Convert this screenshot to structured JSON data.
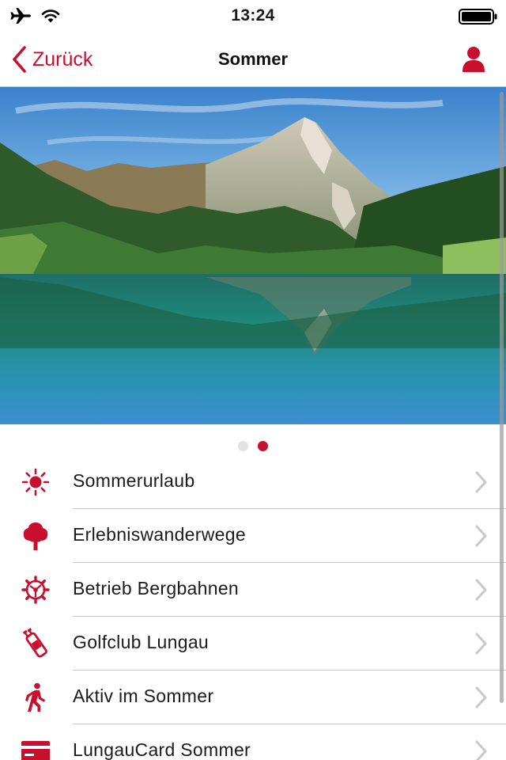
{
  "status_bar": {
    "time": "13:24",
    "icons": [
      "airplane-icon",
      "wifi-icon",
      "battery-icon"
    ]
  },
  "nav": {
    "back_label": "Zurück",
    "title": "Sommer",
    "profile_icon": "user-icon"
  },
  "hero": {
    "image": "mountain-lake-photo",
    "pager_count": 2,
    "pager_active_index": 1
  },
  "menu": {
    "items": [
      {
        "label": "Sommerurlaub",
        "icon": "sun-icon"
      },
      {
        "label": "Erlebniswanderwege",
        "icon": "tree-icon"
      },
      {
        "label": "Betrieb Bergbahnen",
        "icon": "gear-icon"
      },
      {
        "label": "Golfclub Lungau",
        "icon": "golf-bag-icon"
      },
      {
        "label": "Aktiv im Sommer",
        "icon": "walking-person-icon"
      },
      {
        "label": "LungauCard Sommer",
        "icon": "card-icon"
      }
    ]
  },
  "colors": {
    "accent": "#c8102e",
    "separator": "#c8c8c8",
    "chevron": "#c7c7cc",
    "text": "#1a1a1a"
  }
}
